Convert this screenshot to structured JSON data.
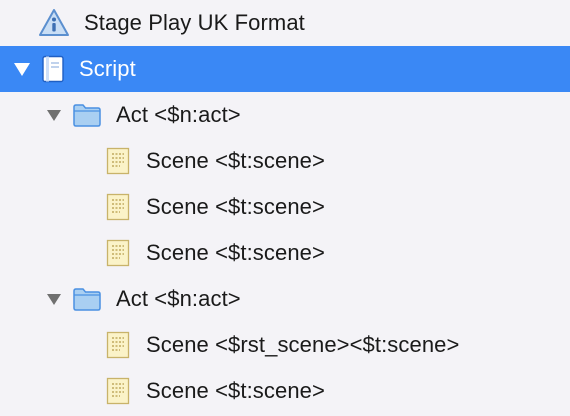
{
  "binder": {
    "items": [
      {
        "label": "Stage Play UK Format",
        "icon": "warning-info-icon",
        "level": 0,
        "selected": false
      },
      {
        "label": "Script",
        "icon": "document-icon",
        "level": 0,
        "selected": true,
        "expanded": true
      },
      {
        "label": "Act <$n:act>",
        "icon": "folder-icon",
        "level": 1,
        "selected": false,
        "expanded": true
      },
      {
        "label": "Scene <$t:scene>",
        "icon": "index-card-icon",
        "level": 2,
        "selected": false
      },
      {
        "label": "Scene <$t:scene>",
        "icon": "index-card-icon",
        "level": 2,
        "selected": false
      },
      {
        "label": "Scene <$t:scene>",
        "icon": "index-card-icon",
        "level": 2,
        "selected": false
      },
      {
        "label": "Act <$n:act>",
        "icon": "folder-icon",
        "level": 1,
        "selected": false,
        "expanded": true
      },
      {
        "label": "Scene <$rst_scene><$t:scene>",
        "icon": "index-card-icon",
        "level": 2,
        "selected": false
      },
      {
        "label": "Scene <$t:scene>",
        "icon": "index-card-icon",
        "level": 2,
        "selected": false
      }
    ]
  },
  "colors": {
    "background": "#f4f3f7",
    "selection": "#3a88f5",
    "folder_fill": "#a9cff2",
    "folder_stroke": "#4a90e2",
    "card_fill": "#fbf3c8",
    "card_stroke": "#c8b36a"
  }
}
